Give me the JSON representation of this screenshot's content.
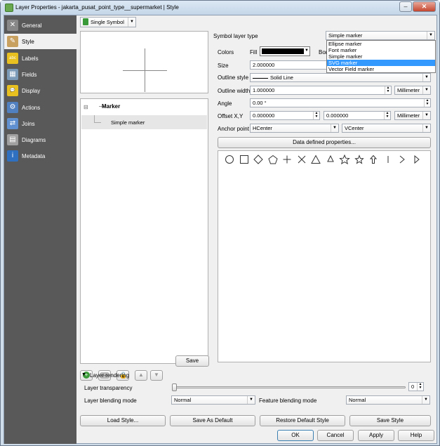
{
  "window": {
    "title": "Layer Properties - jakarta_pusat_point_type__supermarket | Style"
  },
  "window_controls": {
    "minimize": "–",
    "maximize": "□",
    "close": "✕"
  },
  "sidebar": {
    "items": [
      {
        "label": "General",
        "icon": "wrench-icon",
        "color": "#888888",
        "glyph": "✕"
      },
      {
        "label": "Style",
        "icon": "brush-icon",
        "color": "#c8a060",
        "glyph": "✎"
      },
      {
        "label": "Labels",
        "icon": "labels-icon",
        "color": "#e8c020",
        "glyph": "abc"
      },
      {
        "label": "Fields",
        "icon": "table-icon",
        "color": "#7a9ab8",
        "glyph": "▦"
      },
      {
        "label": "Display",
        "icon": "speech-bubble-icon",
        "color": "#e8c020",
        "glyph": "💬"
      },
      {
        "label": "Actions",
        "icon": "gear-icon",
        "color": "#5080c0",
        "glyph": "⚙"
      },
      {
        "label": "Joins",
        "icon": "joins-icon",
        "color": "#6090d0",
        "glyph": "⇄"
      },
      {
        "label": "Diagrams",
        "icon": "diagram-icon",
        "color": "#a0a0a0",
        "glyph": "▤"
      },
      {
        "label": "Metadata",
        "icon": "info-icon",
        "color": "#3070c0",
        "glyph": "i"
      }
    ]
  },
  "renderer": {
    "value": "Single Symbol",
    "icon": "renderer-icon"
  },
  "tree": {
    "root": "Marker",
    "child": "Simple marker",
    "expander": "⊟"
  },
  "symbol_layer": {
    "type_label": "Symbol layer type",
    "type_value": "Simple marker",
    "dropdown_options": [
      "Ellipse marker",
      "Font marker",
      "Simple marker",
      "SVG marker",
      "Vector Field marker"
    ],
    "dropdown_highlight": "SVG marker"
  },
  "props": {
    "colors_label": "Colors",
    "fill_label": "Fill",
    "fill_color": "#000000",
    "border_label": "Bor",
    "size_label": "Size",
    "size_value": "2.000000",
    "outline_style_label": "Outline style",
    "outline_style_value": "Solid Line",
    "outline_width_label": "Outline width",
    "outline_width_value": "1.000000",
    "outline_unit": "Millimeter",
    "angle_label": "Angle",
    "angle_value": "0.00 °",
    "offset_label": "Offset X,Y",
    "offset_x": "0.000000",
    "offset_y": "0.000000",
    "offset_unit": "Millimeter",
    "anchor_label": "Anchor point",
    "anchor_h": "HCenter",
    "anchor_v": "VCenter",
    "data_defined": "Data defined properties..."
  },
  "shapes": [
    "circle",
    "square",
    "diamond",
    "pentagon",
    "cross",
    "x",
    "triangle",
    "equilateral-triangle",
    "star",
    "regular-star",
    "arrow",
    "line",
    "arrowhead",
    "filled-arrowhead"
  ],
  "layer_buttons": {
    "add": "+",
    "remove": "−",
    "lock": "🔒",
    "up": "▲",
    "down": "▼",
    "save": "Save"
  },
  "rendering": {
    "header": "Layer rendering",
    "transparency_label": "Layer transparency",
    "transparency_value": "0",
    "blending_label": "Layer blending mode",
    "blending_value": "Normal",
    "feature_blending_label": "Feature blending mode",
    "feature_blending_value": "Normal"
  },
  "style_buttons": {
    "load": "Load Style...",
    "save_default": "Save As Default",
    "restore": "Restore Default Style",
    "save_style": "Save Style"
  },
  "dialog_buttons": {
    "ok": "OK",
    "cancel": "Cancel",
    "apply": "Apply",
    "help": "Help"
  }
}
